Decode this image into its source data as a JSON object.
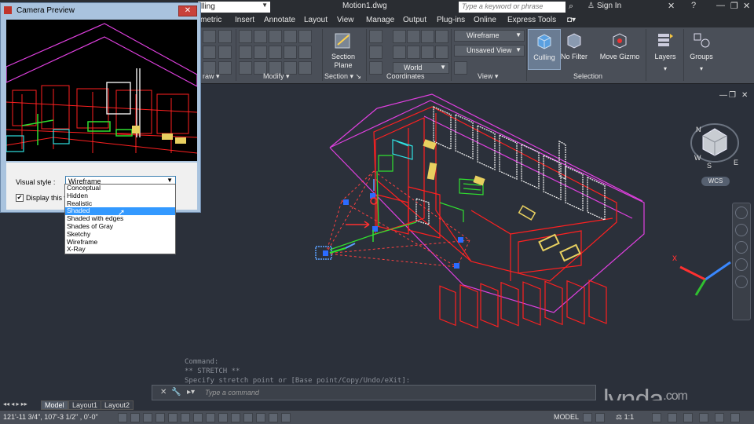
{
  "app": {
    "file_title": "Motion1.dwg",
    "workspace": "lling",
    "search_placeholder": "Type a keyword or phrase",
    "sign_in": "Sign In"
  },
  "menu_tabs": [
    "metric",
    "Insert",
    "Annotate",
    "Layout",
    "View",
    "Manage",
    "Output",
    "Plug-ins",
    "Online",
    "Express Tools"
  ],
  "ribbon": {
    "panels": {
      "draw": "raw",
      "modify": "Modify",
      "section": "Section",
      "coordinates": "Coordinates",
      "view": "View",
      "selection": "Selection"
    },
    "section_plane_label": "Section Plane",
    "visual_style_value": "Wireframe",
    "saved_view_value": "Unsaved View",
    "ucs_value": "World",
    "culling_label": "Culling",
    "no_filter_label": "No Filter",
    "move_gizmo_label": "Move Gizmo",
    "layers_label": "Layers",
    "groups_label": "Groups"
  },
  "viewcube": {
    "wcs_label": "WCS",
    "compass": {
      "n": "N",
      "w": "W",
      "s": "S",
      "e": "E"
    }
  },
  "command": {
    "history": [
      "Command:",
      "** STRETCH **",
      "Specify stretch point or [Base point/Copy/Undo/eXit]:"
    ],
    "placeholder": "Type a command"
  },
  "layout_tabs": [
    "Model",
    "Layout1",
    "Layout2"
  ],
  "status": {
    "coordinates": "121'-11 3/4\", 107'-3 1/2\" , 0'-0\"",
    "model_label": "MODEL",
    "scale_label": "1:1"
  },
  "watermark": "lynda",
  "watermark_suffix": ".com",
  "camera_dialog": {
    "title": "Camera Preview",
    "visual_style_label": "Visual style :",
    "visual_style_value": "Wireframe",
    "display_checkbox_label": "Display this wi",
    "options": [
      "Conceptual",
      "Hidden",
      "Realistic",
      "Shaded",
      "Shaded with edges",
      "Shades of Gray",
      "Sketchy",
      "Wireframe",
      "X-Ray"
    ],
    "highlighted_option": "Shaded"
  },
  "colors": {
    "viewport_bg": "#2b303a",
    "wire_red": "#ff2020",
    "wire_magenta": "#e040e0",
    "wire_green": "#30e030",
    "wire_yellow": "#e8d060",
    "highlight": "#3399ff"
  }
}
